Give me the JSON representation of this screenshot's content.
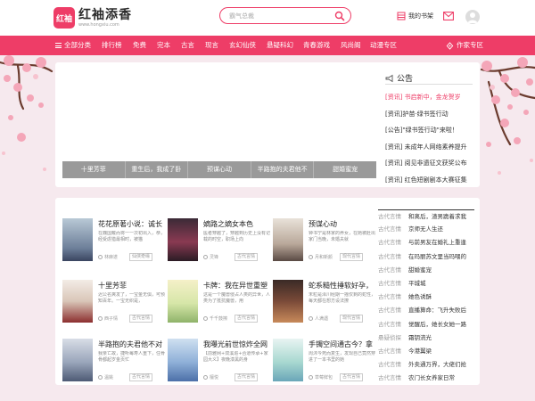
{
  "header": {
    "logo_mark": "红袖",
    "logo_name": "红袖添香",
    "logo_url": "www.hongxiu.com",
    "search_placeholder": "霸气总裁",
    "bookshelf_label": "我的书架"
  },
  "nav": {
    "all_label": "全部分类",
    "items": [
      "排行榜",
      "免费",
      "完本",
      "古言",
      "现言",
      "玄幻仙侠",
      "悬疑科幻",
      "青春游戏",
      "风尚阁",
      "动漫专区"
    ],
    "author_label": "作家专区"
  },
  "slides": [
    "十里芳菲",
    "重生后，我成了卧",
    "预谋心动",
    "半路抱的夫君他不",
    "甜婚蜜宠"
  ],
  "notice": {
    "title": "公告",
    "items": [
      {
        "text": "[资讯] 书启新中，金龙贺岁",
        "hot": true
      },
      {
        "text": "[资讯]护苗·绿书签行动",
        "hot": false
      },
      {
        "text": "[公告]\"绿书签行动\"来啦！",
        "hot": false
      },
      {
        "text": "[资讯] 未成年人网络素养提升",
        "hot": false
      },
      {
        "text": "[资讯] 阅见非遗征文获奖公布",
        "hot": false
      },
      {
        "text": "[资讯] 红色短剧剧本大赛征集",
        "hot": false
      }
    ]
  },
  "books": [
    {
      "title": "花花原著小说：诚长",
      "desc": "在魏国戴而将一一次初出入，恭，经受虐猎最相时，被猫",
      "author": "林麻遂",
      "tag": "仙侠奇缘"
    },
    {
      "title": "嫡路之嫡女本色",
      "desc": "医者穿越了，穿越到历史上没有记载的时空，职场上向",
      "author": "灵锋",
      "tag": "古代言情"
    },
    {
      "title": "预谋心动",
      "desc": "钟书宁是林家的养女，在她被赶出家门当晚，未婚夫就",
      "author": "月和新颜",
      "tag": "现代言情"
    },
    {
      "title": "十里芳菲",
      "desc": "迟公名爽发了，一宝金无俱，可预知百年。一宝无织是，",
      "author": "西子情",
      "tag": "古代言情"
    },
    {
      "title": "卡牌：我在异世重塑",
      "desc": "这是一个魔兽侵占人类的异世，人类为了抵抗魔兽，用",
      "author": "千千鼓擦",
      "tag": "古代言情"
    },
    {
      "title": "蛇系糙性捶软好孕，",
      "desc": "末粒是泽川经期一摇仅剩的蛇性，每天都在想方设法撩",
      "author": "人满遇",
      "tag": "现代言情"
    },
    {
      "title": "半路抱的夫君他不对",
      "desc": "我亲亡故，捷听每寿人重下，住骨骨都起岁金页忙",
      "author": "温姚",
      "tag": "古代言情"
    },
    {
      "title": "我曝光前世惊炸全网",
      "desc": "【前雅网+双溪追+合道传承+家园大义】夜晚漆黑的身",
      "author": "檀悦",
      "tag": "古代言情"
    },
    {
      "title": "手镯空间通古今？拿",
      "desc": "周沐今死而复生，发现自己竟然穿进了一本书里的她",
      "author": "草莓鲜包",
      "tag": "古代言情"
    }
  ],
  "rank": [
    {
      "cat": "古代言情",
      "name": "和离后，渣男跪着求我"
    },
    {
      "cat": "古代言情",
      "name": "京师无人生还"
    },
    {
      "cat": "古代言情",
      "name": "与前男友在婚礼上重逢"
    },
    {
      "cat": "古代言情",
      "name": "在玛丽苏文里当玛喂的"
    },
    {
      "cat": "古代言情",
      "name": "甜婚蜜宠"
    },
    {
      "cat": "古代言情",
      "name": "平城城"
    },
    {
      "cat": "古代言情",
      "name": "她色诱酥"
    },
    {
      "cat": "古代言情",
      "name": "直播算命：飞升失败后"
    },
    {
      "cat": "古代言情",
      "name": "觉醒后，她长女她一路"
    },
    {
      "cat": "悬疑侦探",
      "name": "霜钥流光"
    },
    {
      "cat": "古代言情",
      "name": "今港翼梁"
    },
    {
      "cat": "古代言情",
      "name": "外卖通万界，大佬们抢"
    },
    {
      "cat": "古代言情",
      "name": "农门长女养家日常"
    }
  ],
  "colors": {
    "brand": "#ee3d67",
    "bg": "#f6e9ee",
    "slide_tab_bg": "#9a9a9a"
  }
}
